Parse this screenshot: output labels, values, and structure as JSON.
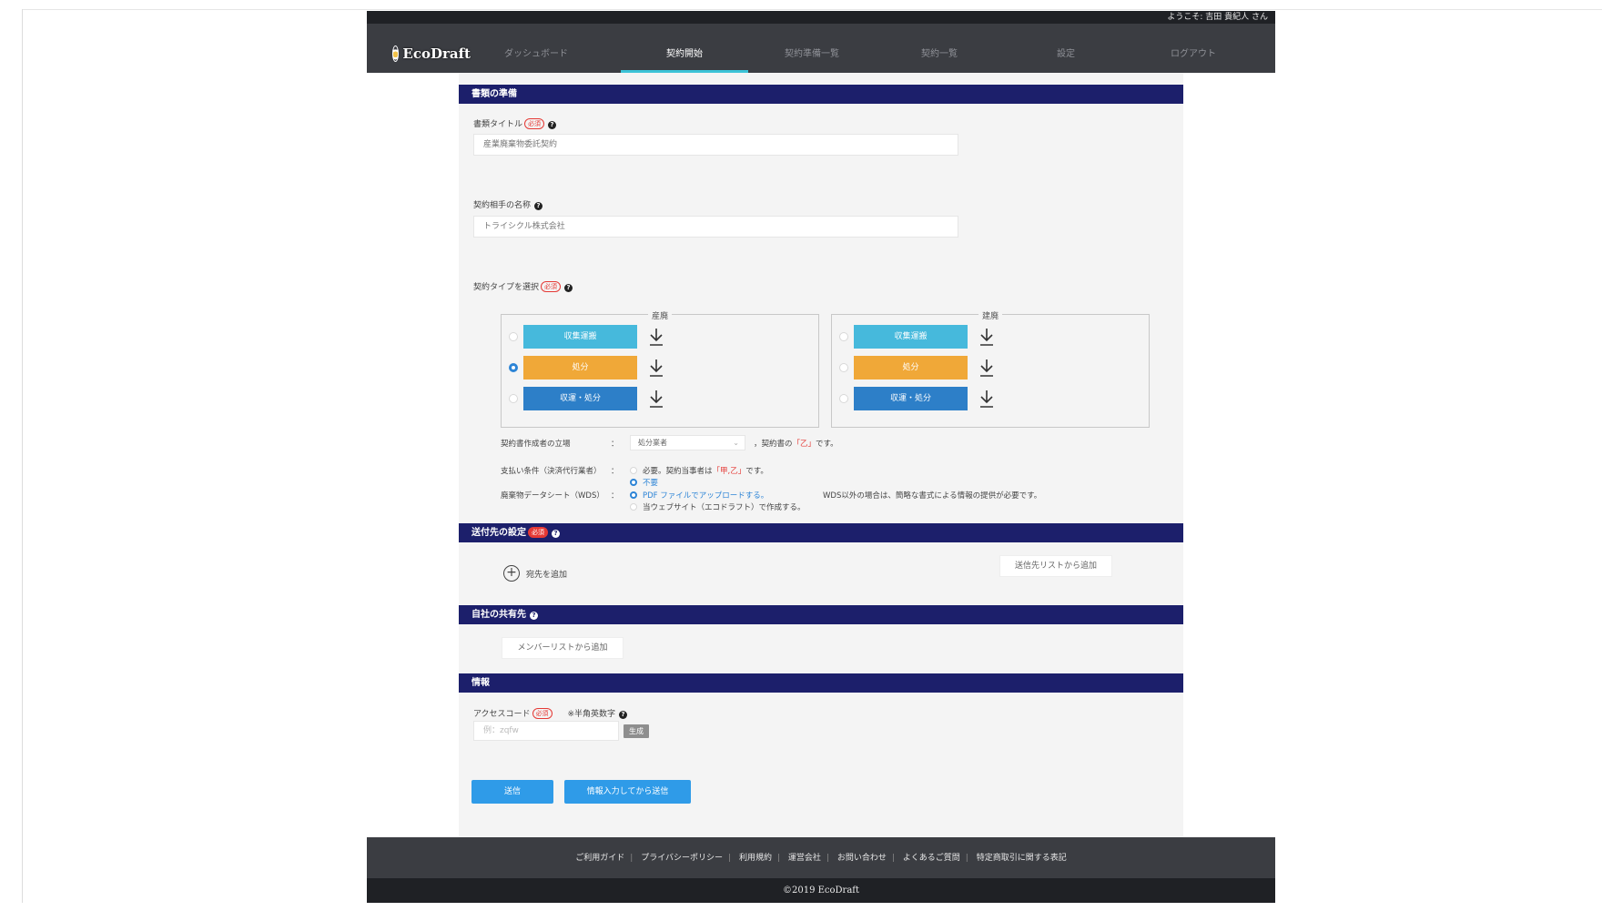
{
  "header": {
    "welcome": "ようこそ: 吉田 貴紀人 さん",
    "logo_text": "EcoDraft",
    "nav": [
      "ダッシュボード",
      "契約開始",
      "契約準備一覧",
      "契約一覧",
      "設定",
      "ログアウト"
    ]
  },
  "doc_prep": {
    "section_title": "書類の準備",
    "title_label": "書類タイトル",
    "required": "必須",
    "title_value": "産業廃棄物委託契約",
    "partner_label": "契約相手の名称",
    "partner_value": "トライシクル株式会社",
    "type_label": "契約タイプを選択",
    "groups": [
      {
        "legend": "産廃",
        "items": [
          "収集運搬",
          "処分",
          "収運・処分"
        ]
      },
      {
        "legend": "建廃",
        "items": [
          "収集運搬",
          "処分",
          "収運・処分"
        ]
      }
    ],
    "creator_label": "契約書作成者の立場",
    "creator_select": "処分業者",
    "creator_suffix_a": "，契約書の",
    "creator_suffix_b": "「乙」",
    "creator_suffix_c": "です。",
    "pay_label": "支払い条件（決済代行業者）",
    "pay_opt1_a": "必要。契約当事者は",
    "pay_opt1_b": "「甲,乙」",
    "pay_opt1_c": "です。",
    "pay_opt2": "不要",
    "wds_label": "廃棄物データシート（WDS）",
    "wds_opt1": "PDF ファイルでアップロードする。",
    "wds_opt2": "当ウェブサイト（エコドラフト）で作成する。",
    "wds_note": "WDS以外の場合は、簡略な書式による情報の提供が必要です。",
    "colon": "："
  },
  "recipients": {
    "section_title": "送付先の設定",
    "required": "必須",
    "add_label": "宛先を追加",
    "from_list": "送信先リストから追加"
  },
  "share": {
    "section_title": "自社の共有先",
    "member_btn": "メンバーリストから追加"
  },
  "info": {
    "section_title": "情報",
    "access_label": "アクセスコード",
    "required": "必須",
    "note": "※半角英数字",
    "placeholder": "例：zqfw",
    "generate": "生成"
  },
  "actions": {
    "send": "送信",
    "send_after": "情報入力してから送信"
  },
  "footer": {
    "links": [
      "ご利用ガイド",
      "プライバシーポリシー",
      "利用規約",
      "運営会社",
      "お問い合わせ",
      "よくあるご質問",
      "特定商取引に関する表記"
    ],
    "copyright": "©2019 EcoDraft"
  },
  "colors": {
    "section": "#1c1f6b",
    "collect": "#46b9dc",
    "dispose": "#f0a838",
    "both": "#2d7fc8",
    "primary": "#2f9be8"
  }
}
